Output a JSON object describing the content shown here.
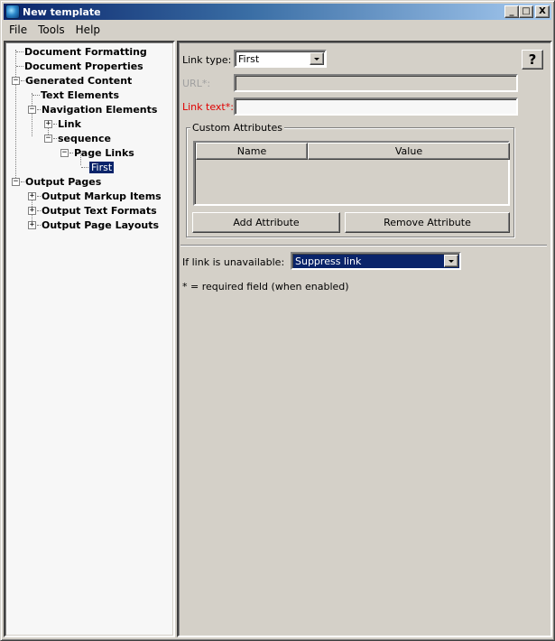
{
  "window": {
    "title": "New template",
    "icon": "app-globe-icon",
    "controls": {
      "minimize": "_",
      "maximize": "□",
      "close": "X"
    }
  },
  "menubar": {
    "items": [
      {
        "label": "File"
      },
      {
        "label": "Tools"
      },
      {
        "label": "Help"
      }
    ]
  },
  "tree": {
    "items": [
      {
        "label": "Document Formatting",
        "level": 0,
        "toggle": "none"
      },
      {
        "label": "Document Properties",
        "level": 0,
        "toggle": "none"
      },
      {
        "label": "Generated Content",
        "level": 0,
        "toggle": "−"
      },
      {
        "label": "Text Elements",
        "level": 1,
        "toggle": "none"
      },
      {
        "label": "Navigation Elements",
        "level": 1,
        "toggle": "−"
      },
      {
        "label": "Link",
        "level": 2,
        "toggle": "+"
      },
      {
        "label": "sequence",
        "level": 2,
        "toggle": "−"
      },
      {
        "label": "Page Links",
        "level": 3,
        "toggle": "−"
      },
      {
        "label": "First",
        "level": 4,
        "toggle": "none",
        "selected": true
      },
      {
        "label": "Output Pages",
        "level": 0,
        "toggle": "−"
      },
      {
        "label": "Output Markup Items",
        "level": 1,
        "toggle": "+"
      },
      {
        "label": "Output Text Formats",
        "level": 1,
        "toggle": "+"
      },
      {
        "label": "Output Page Layouts",
        "level": 1,
        "toggle": "+"
      }
    ]
  },
  "form": {
    "link_type_label": "Link type:",
    "link_type_value": "First",
    "help_label": "?",
    "url_label": "URL*:",
    "url_value": "",
    "link_text_label": "Link text*:",
    "link_text_value": "",
    "custom_attributes": {
      "title": "Custom Attributes",
      "columns": [
        "Name",
        "Value"
      ],
      "rows": [],
      "add_button": "Add Attribute",
      "remove_button": "Remove Attribute"
    },
    "unavailable_label": "If link is unavailable:",
    "unavailable_value": "Suppress link",
    "required_note": "* = required field (when enabled)"
  }
}
